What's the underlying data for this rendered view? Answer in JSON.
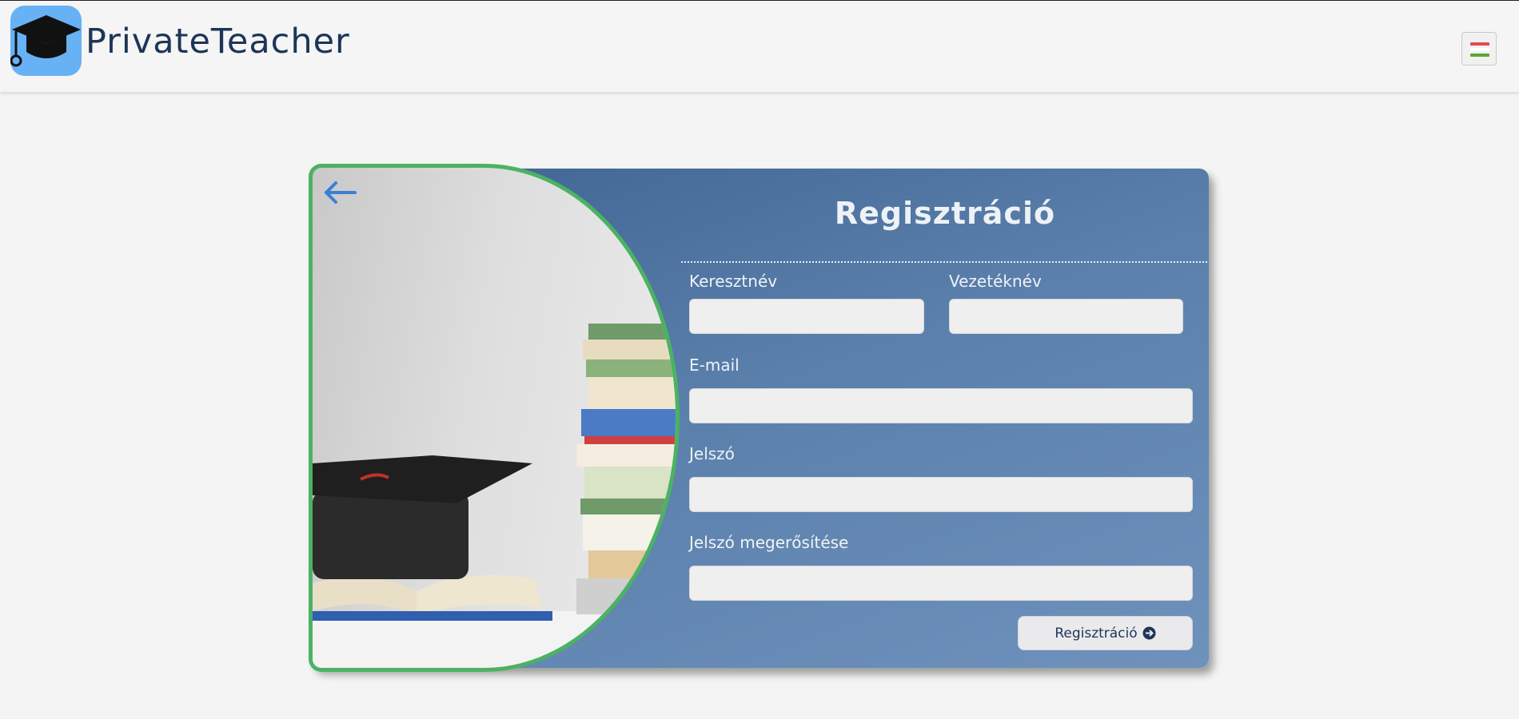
{
  "header": {
    "brand": "PrivateTeacher",
    "logo_icon": "graduation-cap-icon",
    "language_flag": "hungarian-flag-icon",
    "flag_colors": [
      "#e04a4a",
      "#ffffff",
      "#5aa63a"
    ]
  },
  "form": {
    "back_icon": "arrow-left-icon",
    "title": "Regisztráció",
    "first_name_label": "Keresztnév",
    "first_name_value": "",
    "last_name_label": "Vezetéknév",
    "last_name_value": "",
    "email_label": "E-mail",
    "email_value": "",
    "password_label": "Jelszó",
    "password_value": "",
    "password_confirm_label": "Jelszó megerősítése",
    "password_confirm_value": "",
    "submit_label": "Regisztráció",
    "submit_icon": "arrow-circle-right-icon"
  },
  "colors": {
    "brand_text": "#1d3557",
    "logo_bg": "#67b1f5",
    "card_gradient_start": "#3f6391",
    "card_gradient_end": "#6e92bc",
    "image_border": "#4cb263",
    "back_arrow": "#3a7fd6"
  }
}
